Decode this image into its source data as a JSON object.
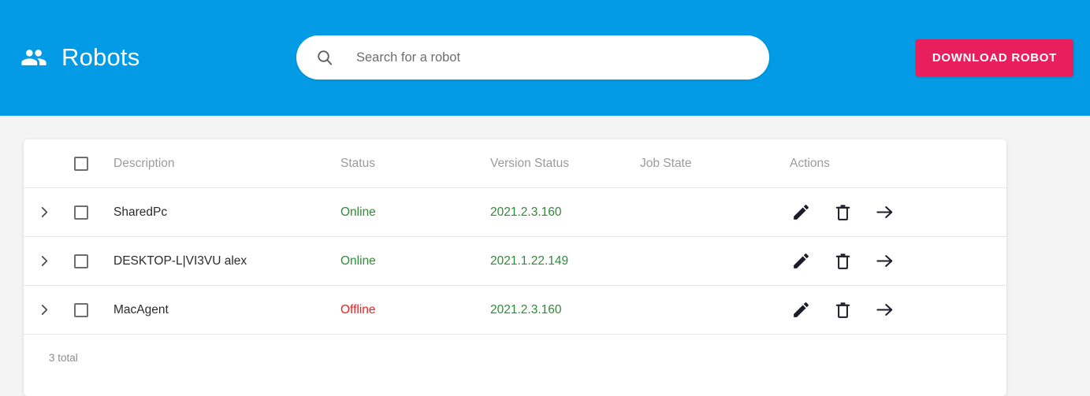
{
  "header": {
    "title": "Robots",
    "icon": "people-group-icon",
    "background_color": "#039be5",
    "search": {
      "icon": "search-icon",
      "placeholder": "Search for a robot",
      "value": ""
    },
    "download_button": {
      "label": "DOWNLOAD ROBOT",
      "color": "#e91e5c"
    }
  },
  "table": {
    "select_all_checkbox": false,
    "columns": [
      {
        "key": "description",
        "label": "Description"
      },
      {
        "key": "status",
        "label": "Status"
      },
      {
        "key": "version_status",
        "label": "Version Status"
      },
      {
        "key": "job_state",
        "label": "Job State"
      },
      {
        "key": "actions",
        "label": "Actions"
      }
    ],
    "rows": [
      {
        "expand_icon": "chevron-right-icon",
        "checked": false,
        "description": "SharedPc",
        "status": "Online",
        "status_color": "#2e8b36",
        "version_status": "2021.2.3.160",
        "version_color": "#2e8b36",
        "job_state": "",
        "actions": [
          "edit-icon",
          "delete-icon",
          "open-icon"
        ]
      },
      {
        "expand_icon": "chevron-right-icon",
        "checked": false,
        "description": "DESKTOP-L|VI3VU alex",
        "status": "Online",
        "status_color": "#2e8b36",
        "version_status": "2021.1.22.149",
        "version_color": "#2e8b36",
        "job_state": "",
        "actions": [
          "edit-icon",
          "delete-icon",
          "open-icon"
        ]
      },
      {
        "expand_icon": "chevron-right-icon",
        "checked": false,
        "description": "MacAgent",
        "status": "Offline",
        "status_color": "#f02020",
        "version_status": "2021.2.3.160",
        "version_color": "#2e8b36",
        "job_state": "",
        "actions": [
          "edit-icon",
          "delete-icon",
          "open-icon"
        ]
      }
    ],
    "footer": {
      "total_label": "3 total"
    }
  }
}
